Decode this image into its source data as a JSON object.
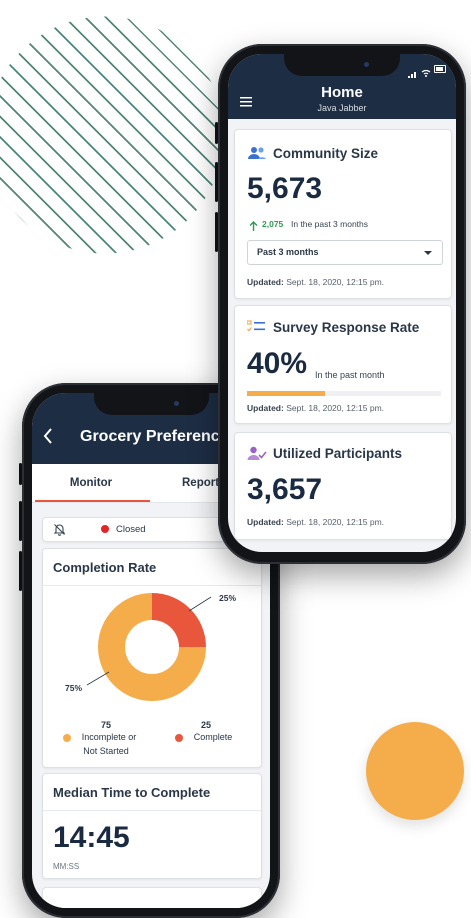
{
  "home": {
    "title": "Home",
    "subtitle": "Java Jabber",
    "community": {
      "title": "Community Size",
      "value": "5,673",
      "change": "2,075",
      "change_text": "In the past 3 months",
      "select_value": "Past 3 months",
      "updated_label": "Updated:",
      "updated": "Sept. 18, 2020, 12:15 pm."
    },
    "survey": {
      "title": "Survey Response Rate",
      "value": "40%",
      "sub": "In the past month",
      "progress": 0.4,
      "updated_label": "Updated:",
      "updated": "Sept. 18, 2020, 12:15 pm."
    },
    "utilized": {
      "title": "Utilized Participants",
      "value": "3,657",
      "updated_label": "Updated:",
      "updated": "Sept. 18, 2020, 12:15 pm."
    }
  },
  "grocery": {
    "title": "Grocery Preferences",
    "tabs": [
      {
        "label": "Monitor",
        "active": true
      },
      {
        "label": "Report",
        "active": false
      }
    ],
    "status": "Closed",
    "completion": {
      "title": "Completion Rate",
      "legend": [
        {
          "value": "75",
          "label_line1": "Incomplete or",
          "label_line2": "Not Started",
          "color": "#f5ad4b"
        },
        {
          "value": "25",
          "label_line1": "Complete",
          "label_line2": "",
          "color": "#e8573c"
        }
      ]
    },
    "median": {
      "title": "Median Time to Complete",
      "value": "14:45",
      "unit": "MM:SS"
    }
  },
  "chart_data": {
    "type": "pie",
    "categories": [
      "Incomplete or Not Started",
      "Complete"
    ],
    "values": [
      75,
      25
    ],
    "labels": [
      "75%",
      "25%"
    ],
    "colors": [
      "#f5ad4b",
      "#e8573c"
    ]
  },
  "colors": {
    "header": "#1d2d44",
    "accent_orange": "#f5ad4b",
    "accent_red": "#e8573c",
    "up_green": "#2e9a53",
    "status_red": "#e52424"
  }
}
